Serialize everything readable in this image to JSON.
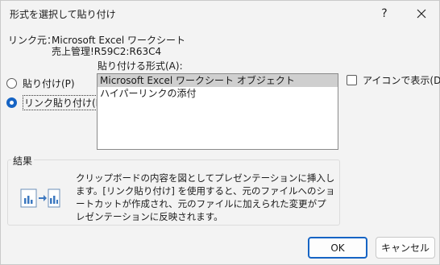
{
  "window": {
    "title": "形式を選択して貼り付け",
    "help_label": "?"
  },
  "link_source": {
    "label": "リンク元：",
    "line1": "Microsoft Excel ワークシート",
    "line2": "売上管理!R59C2:R63C4"
  },
  "format": {
    "label": "貼り付ける形式(A):",
    "items": [
      "Microsoft Excel ワークシート オブジェクト",
      "ハイパーリンクの添付"
    ],
    "selected_index": 0
  },
  "options": {
    "paste_label": "貼り付け(P)",
    "link_paste_label": "リンク貼り付け(I)",
    "selected": "link_paste"
  },
  "display_as_icon": {
    "label": "アイコンで表示(D)",
    "checked": false
  },
  "result": {
    "title": "結果",
    "text": "クリップボードの内容を図としてプレゼンテーションに挿入します。[リンク貼り付け] を使用すると、元のファイルへのショートカットが作成され、元のファイルに加えられた変更がプレゼンテーションに反映されます。",
    "icon": "paste-link-icon"
  },
  "buttons": {
    "ok": "OK",
    "cancel": "キャンセル"
  },
  "colors": {
    "accent": "#1664c4"
  }
}
